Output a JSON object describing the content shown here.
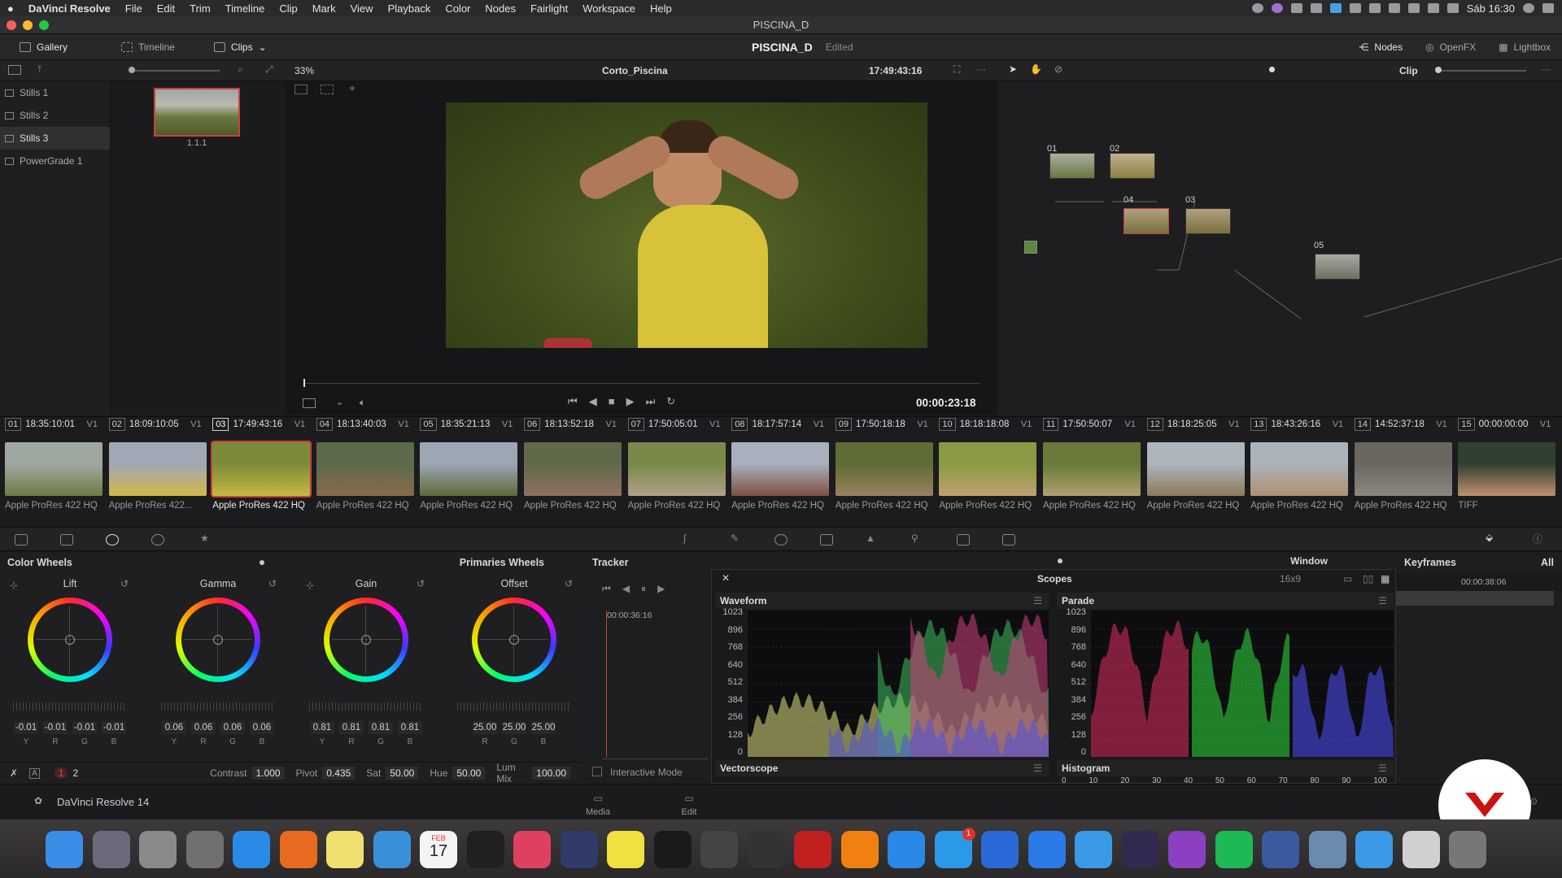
{
  "menubar": {
    "app": "DaVinci Resolve",
    "items": [
      "File",
      "Edit",
      "Trim",
      "Timeline",
      "Clip",
      "Mark",
      "View",
      "Playback",
      "Color",
      "Nodes",
      "Fairlight",
      "Workspace",
      "Help"
    ],
    "clock": "Sáb 16:30"
  },
  "window": {
    "title": "PISCINA_D"
  },
  "toolbar": {
    "gallery": "Gallery",
    "timeline": "Timeline",
    "clips": "Clips",
    "project": "PISCINA_D",
    "status": "Edited",
    "nodes": "Nodes",
    "openfx": "OpenFX",
    "lightbox": "Lightbox"
  },
  "subbar": {
    "zoom": "33%",
    "clip_name": "Corto_Piscina",
    "timecode": "17:49:43:16",
    "mode": "Clip"
  },
  "stills": [
    "Stills 1",
    "Stills 2",
    "Stills 3",
    "PowerGrade 1"
  ],
  "gallery": {
    "still_label": "1.1.1"
  },
  "viewer": {
    "timecode": "00:00:23:18"
  },
  "nodes": {
    "labels": [
      "01",
      "02",
      "04",
      "03",
      "05"
    ]
  },
  "clips": [
    {
      "num": "01",
      "tc": "18:35:10:01",
      "track": "V1",
      "codec": "Apple ProRes 422 HQ"
    },
    {
      "num": "02",
      "tc": "18:09:10:05",
      "track": "V1",
      "codec": "Apple ProRes 422..."
    },
    {
      "num": "03",
      "tc": "17:49:43:16",
      "track": "V1",
      "codec": "Apple ProRes 422 HQ"
    },
    {
      "num": "04",
      "tc": "18:13:40:03",
      "track": "V1",
      "codec": "Apple ProRes 422 HQ"
    },
    {
      "num": "05",
      "tc": "18:35:21:13",
      "track": "V1",
      "codec": "Apple ProRes 422 HQ"
    },
    {
      "num": "06",
      "tc": "18:13:52:18",
      "track": "V1",
      "codec": "Apple ProRes 422 HQ"
    },
    {
      "num": "07",
      "tc": "17:50:05:01",
      "track": "V1",
      "codec": "Apple ProRes 422 HQ"
    },
    {
      "num": "08",
      "tc": "18:17:57:14",
      "track": "V1",
      "codec": "Apple ProRes 422 HQ"
    },
    {
      "num": "09",
      "tc": "17:50:18:18",
      "track": "V1",
      "codec": "Apple ProRes 422 HQ"
    },
    {
      "num": "10",
      "tc": "18:18:18:08",
      "track": "V1",
      "codec": "Apple ProRes 422 HQ"
    },
    {
      "num": "11",
      "tc": "17:50:50:07",
      "track": "V1",
      "codec": "Apple ProRes 422 HQ"
    },
    {
      "num": "12",
      "tc": "18:18:25:05",
      "track": "V1",
      "codec": "Apple ProRes 422 HQ"
    },
    {
      "num": "13",
      "tc": "18:43:26:16",
      "track": "V1",
      "codec": "Apple ProRes 422 HQ"
    },
    {
      "num": "14",
      "tc": "14:52:37:18",
      "track": "V1",
      "codec": "Apple ProRes 422 HQ"
    },
    {
      "num": "15",
      "tc": "00:00:00:00",
      "track": "V1",
      "codec": "TIFF"
    }
  ],
  "color_wheels": {
    "title": "Color Wheels",
    "mode": "Primaries Wheels",
    "wheels": [
      {
        "label": "Lift",
        "values": [
          "-0.01",
          "-0.01",
          "-0.01",
          "-0.01"
        ],
        "channels": [
          "Y",
          "R",
          "G",
          "B"
        ]
      },
      {
        "label": "Gamma",
        "values": [
          "0.06",
          "0.06",
          "0.06",
          "0.06"
        ],
        "channels": [
          "Y",
          "R",
          "G",
          "B"
        ]
      },
      {
        "label": "Gain",
        "values": [
          "0.81",
          "0.81",
          "0.81",
          "0.81"
        ],
        "channels": [
          "Y",
          "R",
          "G",
          "B"
        ]
      },
      {
        "label": "Offset",
        "values": [
          "25.00",
          "25.00",
          "25.00"
        ],
        "channels": [
          "R",
          "G",
          "B"
        ]
      }
    ],
    "footer": {
      "page1": "1",
      "page2": "2",
      "contrast_label": "Contrast",
      "contrast": "1.000",
      "pivot_label": "Pivot",
      "pivot": "0.435",
      "sat_label": "Sat",
      "sat": "50.00",
      "hue_label": "Hue",
      "hue": "50.00",
      "lummix_label": "Lum Mix",
      "lummix": "100.00"
    }
  },
  "tracker": {
    "title": "Tracker",
    "timecode": "00:00:36:16",
    "interactive": "Interactive Mode"
  },
  "scopes": {
    "window": "Window",
    "title": "Scopes",
    "aspect": "16x9",
    "waveform": "Waveform",
    "parade": "Parade",
    "vectorscope": "Vectorscope",
    "histogram": "Histogram",
    "y_ticks": [
      "1023",
      "896",
      "768",
      "640",
      "512",
      "384",
      "256",
      "128",
      "0"
    ],
    "hist_ticks": [
      "0",
      "10",
      "20",
      "30",
      "40",
      "50",
      "60",
      "70",
      "80",
      "90",
      "100"
    ]
  },
  "keyframes": {
    "title": "Keyframes",
    "filter": "All",
    "timecode": "00:00:38:06"
  },
  "bottombar": {
    "app": "DaVinci Resolve 14",
    "media": "Media",
    "edit": "Edit"
  },
  "dock": {
    "badge": "1",
    "calendar_month": "FEB",
    "calendar_day": "17"
  }
}
